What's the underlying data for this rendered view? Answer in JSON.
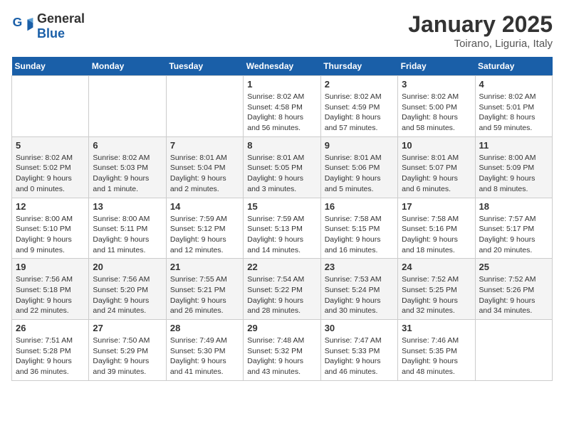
{
  "header": {
    "logo_general": "General",
    "logo_blue": "Blue",
    "title": "January 2025",
    "subtitle": "Toirano, Liguria, Italy"
  },
  "weekdays": [
    "Sunday",
    "Monday",
    "Tuesday",
    "Wednesday",
    "Thursday",
    "Friday",
    "Saturday"
  ],
  "weeks": [
    [
      {
        "day": null,
        "info": null
      },
      {
        "day": null,
        "info": null
      },
      {
        "day": null,
        "info": null
      },
      {
        "day": "1",
        "info": "Sunrise: 8:02 AM\nSunset: 4:58 PM\nDaylight: 8 hours and 56 minutes."
      },
      {
        "day": "2",
        "info": "Sunrise: 8:02 AM\nSunset: 4:59 PM\nDaylight: 8 hours and 57 minutes."
      },
      {
        "day": "3",
        "info": "Sunrise: 8:02 AM\nSunset: 5:00 PM\nDaylight: 8 hours and 58 minutes."
      },
      {
        "day": "4",
        "info": "Sunrise: 8:02 AM\nSunset: 5:01 PM\nDaylight: 8 hours and 59 minutes."
      }
    ],
    [
      {
        "day": "5",
        "info": "Sunrise: 8:02 AM\nSunset: 5:02 PM\nDaylight: 9 hours and 0 minutes."
      },
      {
        "day": "6",
        "info": "Sunrise: 8:02 AM\nSunset: 5:03 PM\nDaylight: 9 hours and 1 minute."
      },
      {
        "day": "7",
        "info": "Sunrise: 8:01 AM\nSunset: 5:04 PM\nDaylight: 9 hours and 2 minutes."
      },
      {
        "day": "8",
        "info": "Sunrise: 8:01 AM\nSunset: 5:05 PM\nDaylight: 9 hours and 3 minutes."
      },
      {
        "day": "9",
        "info": "Sunrise: 8:01 AM\nSunset: 5:06 PM\nDaylight: 9 hours and 5 minutes."
      },
      {
        "day": "10",
        "info": "Sunrise: 8:01 AM\nSunset: 5:07 PM\nDaylight: 9 hours and 6 minutes."
      },
      {
        "day": "11",
        "info": "Sunrise: 8:00 AM\nSunset: 5:09 PM\nDaylight: 9 hours and 8 minutes."
      }
    ],
    [
      {
        "day": "12",
        "info": "Sunrise: 8:00 AM\nSunset: 5:10 PM\nDaylight: 9 hours and 9 minutes."
      },
      {
        "day": "13",
        "info": "Sunrise: 8:00 AM\nSunset: 5:11 PM\nDaylight: 9 hours and 11 minutes."
      },
      {
        "day": "14",
        "info": "Sunrise: 7:59 AM\nSunset: 5:12 PM\nDaylight: 9 hours and 12 minutes."
      },
      {
        "day": "15",
        "info": "Sunrise: 7:59 AM\nSunset: 5:13 PM\nDaylight: 9 hours and 14 minutes."
      },
      {
        "day": "16",
        "info": "Sunrise: 7:58 AM\nSunset: 5:15 PM\nDaylight: 9 hours and 16 minutes."
      },
      {
        "day": "17",
        "info": "Sunrise: 7:58 AM\nSunset: 5:16 PM\nDaylight: 9 hours and 18 minutes."
      },
      {
        "day": "18",
        "info": "Sunrise: 7:57 AM\nSunset: 5:17 PM\nDaylight: 9 hours and 20 minutes."
      }
    ],
    [
      {
        "day": "19",
        "info": "Sunrise: 7:56 AM\nSunset: 5:18 PM\nDaylight: 9 hours and 22 minutes."
      },
      {
        "day": "20",
        "info": "Sunrise: 7:56 AM\nSunset: 5:20 PM\nDaylight: 9 hours and 24 minutes."
      },
      {
        "day": "21",
        "info": "Sunrise: 7:55 AM\nSunset: 5:21 PM\nDaylight: 9 hours and 26 minutes."
      },
      {
        "day": "22",
        "info": "Sunrise: 7:54 AM\nSunset: 5:22 PM\nDaylight: 9 hours and 28 minutes."
      },
      {
        "day": "23",
        "info": "Sunrise: 7:53 AM\nSunset: 5:24 PM\nDaylight: 9 hours and 30 minutes."
      },
      {
        "day": "24",
        "info": "Sunrise: 7:52 AM\nSunset: 5:25 PM\nDaylight: 9 hours and 32 minutes."
      },
      {
        "day": "25",
        "info": "Sunrise: 7:52 AM\nSunset: 5:26 PM\nDaylight: 9 hours and 34 minutes."
      }
    ],
    [
      {
        "day": "26",
        "info": "Sunrise: 7:51 AM\nSunset: 5:28 PM\nDaylight: 9 hours and 36 minutes."
      },
      {
        "day": "27",
        "info": "Sunrise: 7:50 AM\nSunset: 5:29 PM\nDaylight: 9 hours and 39 minutes."
      },
      {
        "day": "28",
        "info": "Sunrise: 7:49 AM\nSunset: 5:30 PM\nDaylight: 9 hours and 41 minutes."
      },
      {
        "day": "29",
        "info": "Sunrise: 7:48 AM\nSunset: 5:32 PM\nDaylight: 9 hours and 43 minutes."
      },
      {
        "day": "30",
        "info": "Sunrise: 7:47 AM\nSunset: 5:33 PM\nDaylight: 9 hours and 46 minutes."
      },
      {
        "day": "31",
        "info": "Sunrise: 7:46 AM\nSunset: 5:35 PM\nDaylight: 9 hours and 48 minutes."
      },
      {
        "day": null,
        "info": null
      }
    ]
  ]
}
